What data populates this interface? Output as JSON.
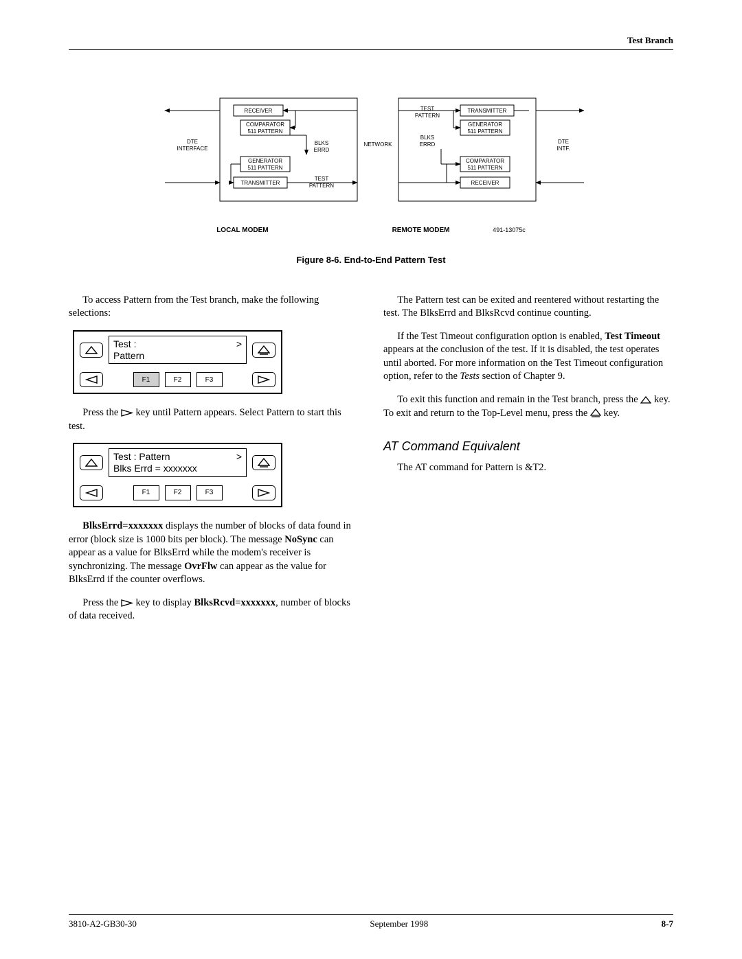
{
  "header": {
    "section": "Test Branch"
  },
  "diagram": {
    "dte_interface": "DTE INTERFACE",
    "receiver": "RECEIVER",
    "comparator": "COMPARATOR",
    "pattern511": "511 PATTERN",
    "generator": "GENERATOR",
    "transmitter": "TRANSMITTER",
    "blks_errd": "BLKS ERRD",
    "test_pattern": "TEST PATTERN",
    "network": "NETWORK",
    "dte_intf": "DTE INTF.",
    "local_modem": "LOCAL MODEM",
    "remote_modem": "REMOTE MODEM",
    "ref_id": "491-13075c"
  },
  "figure_caption": "Figure 8-6. End-to-End Pattern Test",
  "left": {
    "p1": "To access Pattern from the Test branch, make the following selections:",
    "panel1": {
      "line1": "Test   :",
      "gt": ">",
      "line2": "Pattern",
      "f1": "F1",
      "f2": "F2",
      "f3": "F3"
    },
    "p2a": "Press the ",
    "p2b": " key until Pattern appears. Select Pattern to start this test.",
    "panel2": {
      "line1": "Test  : Pattern",
      "gt": ">",
      "line2": "Blks Errd = xxxxxxx",
      "f1": "F1",
      "f2": "F2",
      "f3": "F3"
    },
    "p3a": "BlksErrd=xxxxxxx",
    "p3b": " displays the number of blocks of data found in error (block size is 1000 bits per block). The message ",
    "p3c": "NoSync",
    "p3d": " can appear as a value for BlksErrd while the modem's receiver is synchronizing. The message ",
    "p3e": "OvrFlw",
    "p3f": " can appear as the value for BlksErrd if the counter overflows.",
    "p4a": "Press the ",
    "p4b": " key to display ",
    "p4c": "BlksRcvd=xxxxxxx",
    "p4d": ", number of blocks of data received."
  },
  "right": {
    "p1": "The Pattern test can be exited and reentered without restarting the test. The BlksErrd and BlksRcvd continue counting.",
    "p2a": "If the Test Timeout configuration option is enabled, ",
    "p2b": "Test Timeout",
    "p2c": " appears at the conclusion of the test. If it is disabled, the test operates until aborted. For more information on the Test Timeout configuration option, refer to the ",
    "p2d": "Tests",
    "p2e": " section of Chapter 9.",
    "p3a": "To exit this function and remain in the Test branch, press the ",
    "p3b": " key. To exit and return to the Top-Level menu, press the ",
    "p3c": " key.",
    "subhead": "AT Command Equivalent",
    "p4": "The AT command for Pattern is &T2."
  },
  "footer": {
    "left": "3810-A2-GB30-30",
    "center": "September 1998",
    "right": "8-7"
  }
}
